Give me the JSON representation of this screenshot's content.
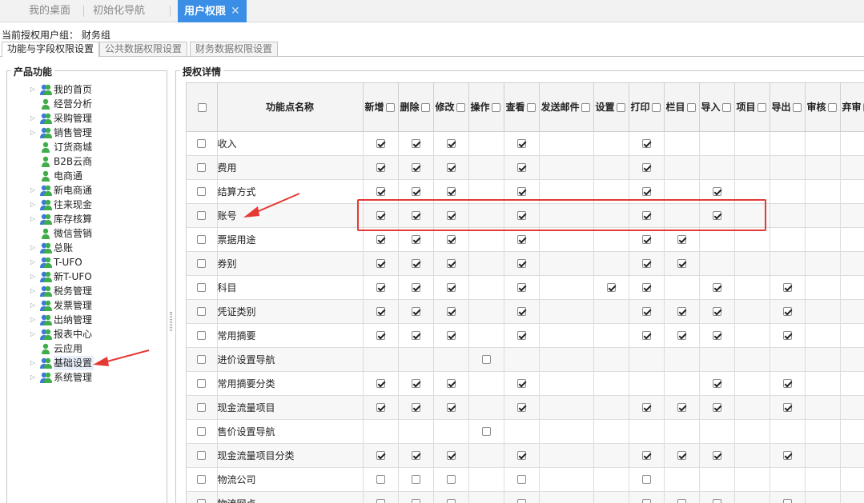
{
  "top_tabs": [
    {
      "label": "我的桌面"
    },
    {
      "label": "初始化导航"
    },
    {
      "label": "用户权限",
      "close": "✕"
    }
  ],
  "current_group": "当前授权用户组： 财务组",
  "sub_tabs": [
    {
      "label": "功能与字段权限设置"
    },
    {
      "label": "公共数据权限设置"
    },
    {
      "label": "财务数据权限设置"
    }
  ],
  "left_panel": {
    "title": "产品功能",
    "items": [
      {
        "label": "我的首页",
        "expand": true,
        "icon": "user-group-icon"
      },
      {
        "label": "经营分析",
        "expand": false,
        "icon": "user-icon"
      },
      {
        "label": "采购管理",
        "expand": true,
        "icon": "user-group-icon"
      },
      {
        "label": "销售管理",
        "expand": true,
        "icon": "user-group-icon"
      },
      {
        "label": "订货商城",
        "expand": false,
        "icon": "user-icon"
      },
      {
        "label": "B2B云商",
        "expand": false,
        "icon": "user-icon"
      },
      {
        "label": "电商通",
        "expand": false,
        "icon": "user-icon"
      },
      {
        "label": "新电商通",
        "expand": true,
        "icon": "user-group-icon"
      },
      {
        "label": "往来现金",
        "expand": true,
        "icon": "user-group-icon"
      },
      {
        "label": "库存核算",
        "expand": true,
        "icon": "user-group-icon"
      },
      {
        "label": "微信营销",
        "expand": false,
        "icon": "user-icon"
      },
      {
        "label": "总账",
        "expand": true,
        "icon": "user-group-icon"
      },
      {
        "label": "T-UFO",
        "expand": true,
        "icon": "user-group-icon"
      },
      {
        "label": "新T-UFO",
        "expand": true,
        "icon": "user-group-icon"
      },
      {
        "label": "税务管理",
        "expand": true,
        "icon": "user-group-icon"
      },
      {
        "label": "发票管理",
        "expand": true,
        "icon": "user-group-icon"
      },
      {
        "label": "出纳管理",
        "expand": true,
        "icon": "user-group-icon"
      },
      {
        "label": "报表中心",
        "expand": true,
        "icon": "user-group-icon"
      },
      {
        "label": "云应用",
        "expand": false,
        "icon": "user-icon"
      },
      {
        "label": "基础设置",
        "expand": true,
        "icon": "user-group-icon",
        "selected": true
      },
      {
        "label": "系统管理",
        "expand": true,
        "icon": "user-group-icon"
      }
    ]
  },
  "right_panel": {
    "title": "授权详情",
    "name_header": "功能点名称",
    "columns": [
      "新增",
      "删除",
      "修改",
      "操作",
      "查看",
      "发送邮件",
      "设置",
      "打印",
      "栏目",
      "导入",
      "项目",
      "导出",
      "审核",
      "弃审"
    ],
    "rows": [
      {
        "name": "收入",
        "cells": [
          "c",
          "c",
          "c",
          "",
          "c",
          "",
          "",
          "c",
          "",
          "",
          "",
          "",
          "",
          ""
        ]
      },
      {
        "name": "费用",
        "cells": [
          "c",
          "c",
          "c",
          "",
          "c",
          "",
          "",
          "c",
          "",
          "",
          "",
          "",
          "",
          ""
        ]
      },
      {
        "name": "结算方式",
        "cells": [
          "c",
          "c",
          "c",
          "",
          "c",
          "",
          "",
          "c",
          "",
          "c",
          "",
          "",
          "",
          ""
        ]
      },
      {
        "name": "账号",
        "cells": [
          "c",
          "c",
          "c",
          "",
          "c",
          "",
          "",
          "c",
          "",
          "c",
          "",
          "",
          "",
          ""
        ]
      },
      {
        "name": "票据用途",
        "cells": [
          "c",
          "c",
          "c",
          "",
          "c",
          "",
          "",
          "c",
          "c",
          "",
          "",
          "",
          "",
          ""
        ]
      },
      {
        "name": "券别",
        "cells": [
          "c",
          "c",
          "c",
          "",
          "c",
          "",
          "",
          "c",
          "c",
          "",
          "",
          "",
          "",
          ""
        ]
      },
      {
        "name": "科目",
        "cells": [
          "c",
          "c",
          "c",
          "",
          "c",
          "",
          "c",
          "c",
          "",
          "c",
          "",
          "c",
          "",
          ""
        ]
      },
      {
        "name": "凭证类别",
        "cells": [
          "c",
          "c",
          "c",
          "",
          "c",
          "",
          "",
          "c",
          "c",
          "c",
          "",
          "c",
          "",
          ""
        ]
      },
      {
        "name": "常用摘要",
        "cells": [
          "c",
          "c",
          "c",
          "",
          "c",
          "",
          "",
          "c",
          "c",
          "c",
          "",
          "c",
          "",
          ""
        ]
      },
      {
        "name": "进价设置导航",
        "cells": [
          "",
          "",
          "",
          "u",
          "",
          "",
          "",
          "",
          "",
          "",
          "",
          "",
          "",
          ""
        ]
      },
      {
        "name": "常用摘要分类",
        "cells": [
          "c",
          "c",
          "c",
          "",
          "c",
          "",
          "",
          "",
          "",
          "c",
          "",
          "c",
          "",
          ""
        ]
      },
      {
        "name": "现金流量项目",
        "cells": [
          "c",
          "c",
          "c",
          "",
          "c",
          "",
          "",
          "c",
          "c",
          "c",
          "",
          "c",
          "",
          ""
        ]
      },
      {
        "name": "售价设置导航",
        "cells": [
          "",
          "",
          "",
          "u",
          "",
          "",
          "",
          "",
          "",
          "",
          "",
          "",
          "",
          ""
        ]
      },
      {
        "name": "现金流量项目分类",
        "cells": [
          "c",
          "c",
          "c",
          "",
          "c",
          "",
          "",
          "c",
          "c",
          "c",
          "",
          "c",
          "",
          ""
        ]
      },
      {
        "name": "物流公司",
        "cells": [
          "u",
          "u",
          "u",
          "",
          "u",
          "",
          "",
          "u",
          "",
          "",
          "",
          "",
          "",
          ""
        ]
      },
      {
        "name": "物流网点",
        "cells": [
          "u",
          "u",
          "u",
          "",
          "u",
          "",
          "",
          "u",
          "u",
          "u",
          "",
          "u",
          "",
          ""
        ]
      }
    ]
  },
  "colors": {
    "accent": "#3a8ee6",
    "annotation": "#e53935"
  }
}
